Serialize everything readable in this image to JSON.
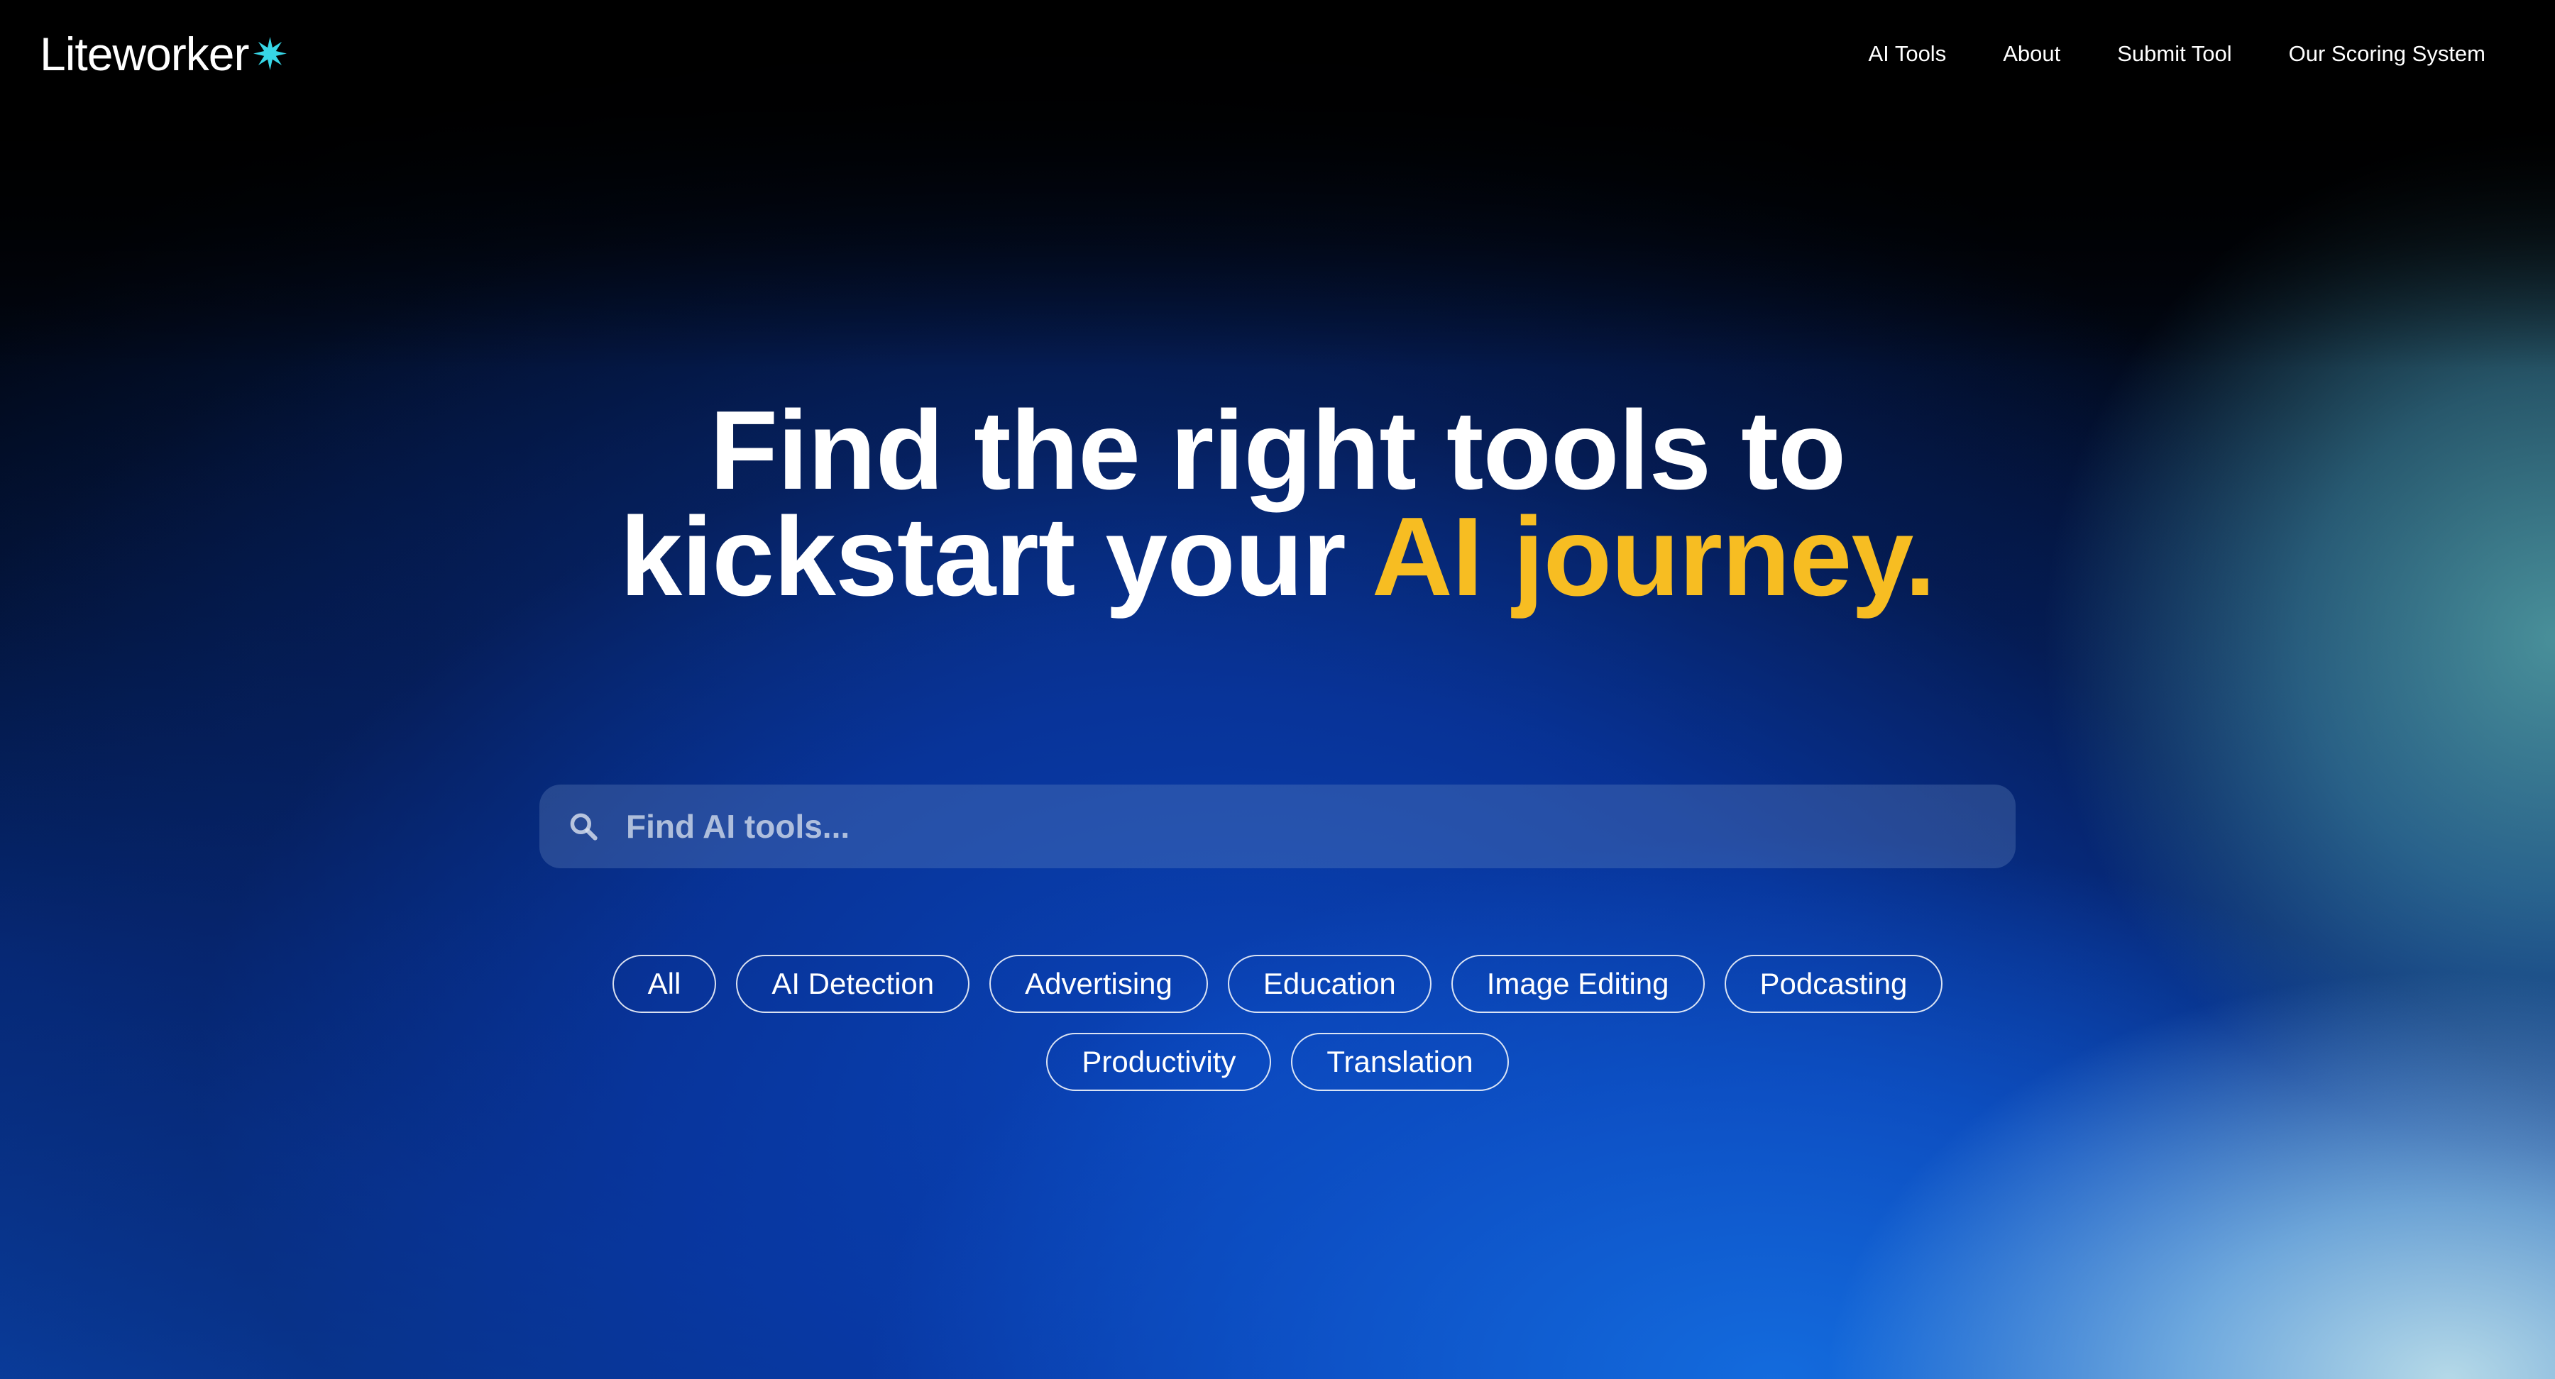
{
  "brand": {
    "name": "Liteworker",
    "star": "✷"
  },
  "nav": {
    "items": [
      {
        "label": "AI Tools"
      },
      {
        "label": "About"
      },
      {
        "label": "Submit Tool"
      },
      {
        "label": "Our Scoring System"
      }
    ]
  },
  "hero": {
    "line1": "Find the right tools to",
    "line2_prefix": "kickstart your ",
    "line2_accent": "AI journey."
  },
  "search": {
    "placeholder": "Find AI tools..."
  },
  "categories": {
    "row1": [
      "All",
      "AI Detection",
      "Advertising",
      "Education",
      "Image Editing",
      "Podcasting"
    ],
    "row2": [
      "Productivity",
      "Translation"
    ]
  },
  "colors": {
    "accent": "#f7bd22",
    "logo_star": "#37d6e6",
    "background_top": "#000000",
    "background_blue": "#0a3fa0"
  },
  "icons": {
    "search": "search-icon",
    "logo_star": "sparkle-star-icon"
  }
}
